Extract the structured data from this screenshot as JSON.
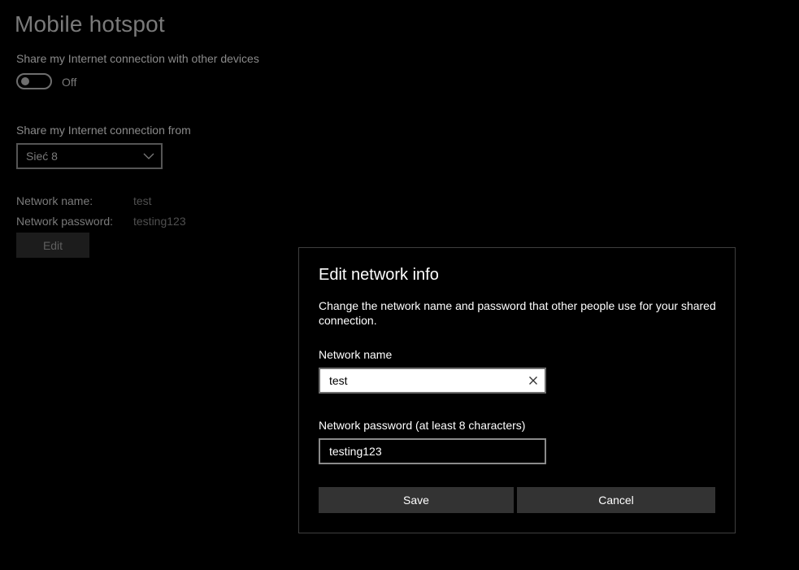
{
  "page": {
    "title": "Mobile hotspot",
    "share_label": "Share my Internet connection with other devices",
    "toggle_state": "Off",
    "share_from_label": "Share my Internet connection from",
    "share_from_value": "Sieć 8",
    "network_name_label": "Network name:",
    "network_name_value": "test",
    "network_password_label": "Network password:",
    "network_password_value": "testing123",
    "edit_label": "Edit"
  },
  "dialog": {
    "title": "Edit network info",
    "description": "Change the network name and password that other people use for your shared connection.",
    "name_label": "Network name",
    "name_value": "test",
    "password_label": "Network password (at least 8 characters)",
    "password_value": "testing123",
    "save_label": "Save",
    "cancel_label": "Cancel"
  },
  "icons": {
    "select": "chevron-down-icon",
    "clear": "close-icon"
  },
  "colors": {
    "background": "#000000",
    "dialog_border": "#3f3f3f",
    "button": "#333333",
    "text": "#ffffff",
    "dimmed_text": "#7a7a7a"
  }
}
